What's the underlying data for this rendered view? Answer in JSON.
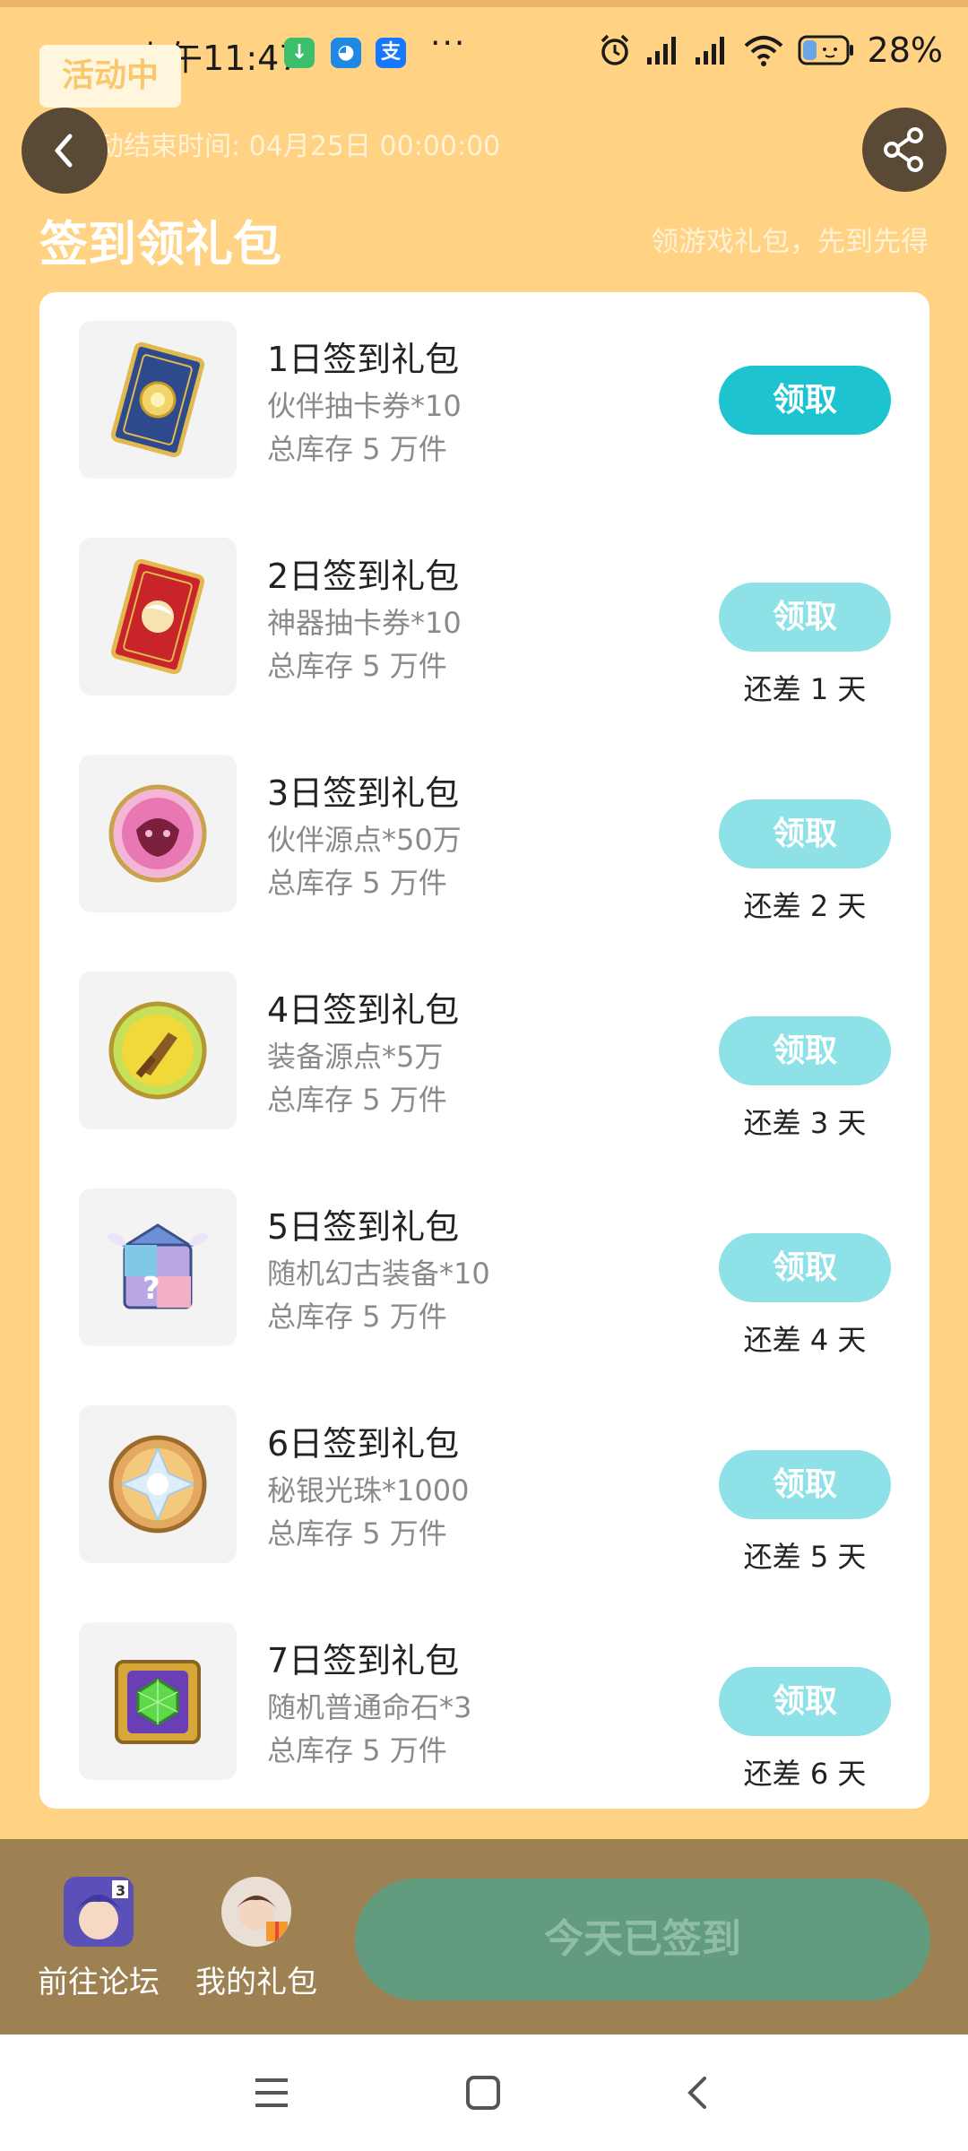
{
  "status_bar": {
    "time": "上午11:47",
    "more": "···",
    "battery": "28%"
  },
  "activity": {
    "badge": "活动中",
    "end_time": "活动结束时间: 04月25日 00:00:00"
  },
  "section": {
    "title": "签到领礼包",
    "subtitle": "领游戏礼包，先到先得"
  },
  "gifts": [
    {
      "title": "1日签到礼包",
      "item": "伙伴抽卡券*10",
      "stock": "总库存 5 万件",
      "button": "领取",
      "days_left": "",
      "icon": "partner-card-icon"
    },
    {
      "title": "2日签到礼包",
      "item": "神器抽卡券*10",
      "stock": "总库存 5 万件",
      "button": "领取",
      "days_left": "还差 1 天",
      "icon": "artifact-card-icon"
    },
    {
      "title": "3日签到礼包",
      "item": "伙伴源点*50万",
      "stock": "总库存 5 万件",
      "button": "领取",
      "days_left": "还差 2 天",
      "icon": "partner-orb-icon"
    },
    {
      "title": "4日签到礼包",
      "item": "装备源点*5万",
      "stock": "总库存 5 万件",
      "button": "领取",
      "days_left": "还差 3 天",
      "icon": "equipment-orb-icon"
    },
    {
      "title": "5日签到礼包",
      "item": "随机幻古装备*10",
      "stock": "总库存 5 万件",
      "button": "领取",
      "days_left": "还差 4 天",
      "icon": "mystery-chest-icon"
    },
    {
      "title": "6日签到礼包",
      "item": "秘银光珠*1000",
      "stock": "总库存 5 万件",
      "button": "领取",
      "days_left": "还差 5 天",
      "icon": "mithril-orb-icon"
    },
    {
      "title": "7日签到礼包",
      "item": "随机普通命石*3",
      "stock": "总库存 5 万件",
      "button": "领取",
      "days_left": "还差 6 天",
      "icon": "gem-chest-icon"
    }
  ],
  "bottom": {
    "forum_label": "前往论坛",
    "my_gifts_label": "我的礼包",
    "signed_label": "今天已签到"
  },
  "colors": {
    "background": "#FFD383",
    "claim_active": "#1DC4CF",
    "claim_disabled": "#8DE1E7",
    "bottom_bar": "#9D8152",
    "signed_button": "#629B7E"
  }
}
